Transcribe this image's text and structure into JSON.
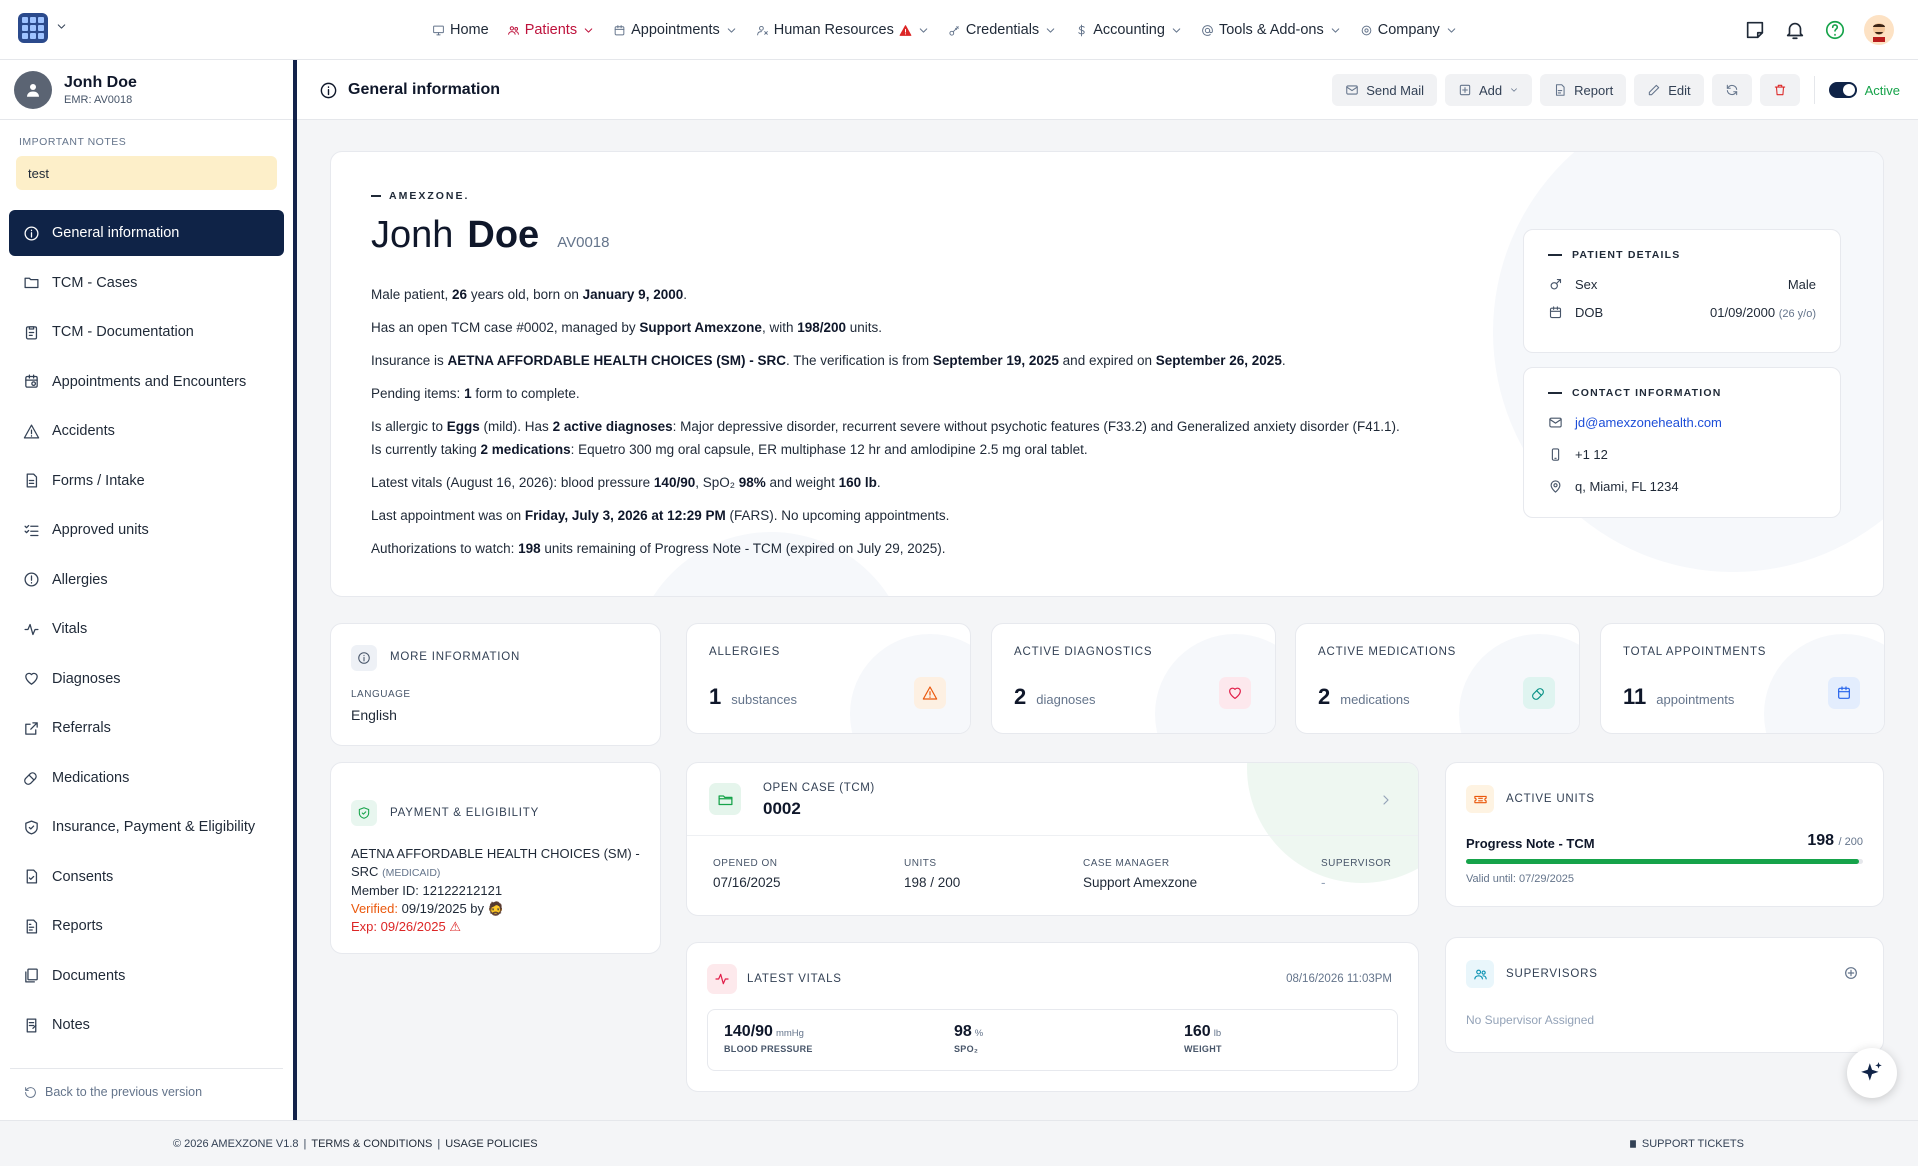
{
  "nav": {
    "items": [
      {
        "label": "Home",
        "icon": "monitor-icon"
      },
      {
        "label": "Patients",
        "icon": "users-icon"
      },
      {
        "label": "Appointments",
        "icon": "calendar-icon"
      },
      {
        "label": "Human Resources",
        "icon": "user-icon"
      },
      {
        "label": "Credentials",
        "icon": "key-icon"
      },
      {
        "label": "Accounting",
        "icon": "dollar-icon"
      },
      {
        "label": "Tools & Add-ons",
        "icon": "at-icon"
      },
      {
        "label": "Company",
        "icon": "gear-icon"
      }
    ]
  },
  "patient": {
    "name": "Jonh Doe",
    "first": "Jonh",
    "last": "Doe",
    "emr": "EMR: AV0018",
    "code": "AV0018"
  },
  "notes": {
    "label": "IMPORTANT NOTES",
    "text": "test"
  },
  "sidebar": {
    "items": [
      {
        "label": "General information",
        "icon": "info-icon"
      },
      {
        "label": "TCM - Cases",
        "icon": "folder-icon"
      },
      {
        "label": "TCM - Documentation",
        "icon": "clipboard-icon"
      },
      {
        "label": "Appointments and Encounters",
        "icon": "calendar-clock-icon"
      },
      {
        "label": "Accidents",
        "icon": "warning-icon"
      },
      {
        "label": "Forms / Intake",
        "icon": "file-icon"
      },
      {
        "label": "Approved units",
        "icon": "list-check-icon"
      },
      {
        "label": "Allergies",
        "icon": "alert-circle-icon"
      },
      {
        "label": "Vitals",
        "icon": "pulse-icon"
      },
      {
        "label": "Diagnoses",
        "icon": "heart-icon"
      },
      {
        "label": "Referrals",
        "icon": "external-link-icon"
      },
      {
        "label": "Medications",
        "icon": "pill-icon"
      },
      {
        "label": "Insurance, Payment & Eligibility",
        "icon": "shield-icon"
      },
      {
        "label": "Consents",
        "icon": "file-check-icon"
      },
      {
        "label": "Reports",
        "icon": "report-icon"
      },
      {
        "label": "Documents",
        "icon": "documents-icon"
      },
      {
        "label": "Notes",
        "icon": "note-icon"
      }
    ],
    "back": "Back to the previous version"
  },
  "header": {
    "title": "General information",
    "send_mail": "Send Mail",
    "add": "Add",
    "report": "Report",
    "edit": "Edit",
    "status": "Active"
  },
  "summary": {
    "brand": "AMEXZONE.",
    "lines": [
      [
        [
          "Male patient, ",
          false
        ],
        [
          "26",
          true
        ],
        [
          " years old, born on ",
          false
        ],
        [
          "January 9, 2000",
          true
        ],
        [
          ".",
          false
        ]
      ],
      [
        [
          "Has an open TCM case #0002, managed by ",
          false
        ],
        [
          "Support Amexzone",
          true
        ],
        [
          ", with ",
          false
        ],
        [
          "198/200",
          true
        ],
        [
          " units.",
          false
        ]
      ],
      [
        [
          "Insurance is ",
          false
        ],
        [
          "AETNA AFFORDABLE HEALTH CHOICES (SM) - SRC",
          true
        ],
        [
          ". The verification is from ",
          false
        ],
        [
          "September 19, 2025",
          true
        ],
        [
          " and expired on ",
          false
        ],
        [
          "September 26, 2025",
          true
        ],
        [
          ".",
          false
        ]
      ],
      [
        [
          "Pending items: ",
          false
        ],
        [
          "1",
          true
        ],
        [
          " form to complete.",
          false
        ]
      ],
      [
        [
          "Is allergic to ",
          false
        ],
        [
          "Eggs",
          true
        ],
        [
          " (mild). Has ",
          false
        ],
        [
          "2 active diagnoses",
          true
        ],
        [
          ": Major depressive disorder, recurrent severe without psychotic features (F33.2) and Generalized anxiety disorder (F41.1).",
          false
        ]
      ],
      [
        [
          "Is currently taking ",
          false
        ],
        [
          "2 medications",
          true
        ],
        [
          ": Equetro 300 mg oral capsule, ER multiphase 12 hr and amlodipine 2.5 mg oral tablet.",
          false
        ]
      ],
      [
        [
          "Latest vitals (August 16, 2026): blood pressure ",
          false
        ],
        [
          "140/90",
          true
        ],
        [
          ", SpO₂ ",
          false
        ],
        [
          "98%",
          true
        ],
        [
          " and weight ",
          false
        ],
        [
          "160 lb",
          true
        ],
        [
          ".",
          false
        ]
      ],
      [
        [
          "Last appointment was on ",
          false
        ],
        [
          "Friday, July 3, 2026 at 12:29 PM",
          true
        ],
        [
          " (FARS). No upcoming appointments.",
          false
        ]
      ],
      [
        [
          "Authorizations to watch: ",
          false
        ],
        [
          "198",
          true
        ],
        [
          " units remaining of Progress Note - TCM (expired on July 29, 2025).",
          false
        ]
      ]
    ]
  },
  "patient_details": {
    "title": "PATIENT DETAILS",
    "sex_label": "Sex",
    "sex_value": "Male",
    "dob_label": "DOB",
    "dob_value": "01/09/2000",
    "dob_age": "(26 y/o)"
  },
  "contact": {
    "title": "CONTACT INFORMATION",
    "email": "jd@amexzonehealth.com",
    "phone": "+1 12",
    "address": "q, Miami, FL 1234"
  },
  "more_info": {
    "title": "MORE INFORMATION",
    "language_label": "LANGUAGE",
    "language": "English"
  },
  "stats": {
    "allergies": {
      "label": "ALLERGIES",
      "value": "1",
      "unit": "substances",
      "color": "#f97316"
    },
    "diagnostics": {
      "label": "ACTIVE DIAGNOSTICS",
      "value": "2",
      "unit": "diagnoses",
      "color": "#e11d48"
    },
    "medications": {
      "label": "ACTIVE MEDICATIONS",
      "value": "2",
      "unit": "medications",
      "color": "#0d9488"
    },
    "appointments": {
      "label": "TOTAL APPOINTMENTS",
      "value": "11",
      "unit": "appointments",
      "color": "#2563eb"
    }
  },
  "payment": {
    "title": "PAYMENT & ELIGIBILITY",
    "plan": "AETNA AFFORDABLE HEALTH CHOICES (SM) - SRC",
    "plan_type": "(MEDICAID)",
    "member": "Member ID: 12122212121",
    "verified_label": "Verified:",
    "verified_value": "09/19/2025 by",
    "exp": "Exp: 09/26/2025"
  },
  "open_case": {
    "label": "OPEN CASE (TCM)",
    "number": "0002",
    "opened_label": "OPENED ON",
    "opened": "07/16/2025",
    "units_label": "UNITS",
    "units": "198 / 200",
    "manager_label": "CASE MANAGER",
    "manager": "Support Amexzone",
    "supervisor_label": "SUPERVISOR",
    "supervisor": "-"
  },
  "active_units": {
    "title": "ACTIVE UNITS",
    "name": "Progress Note - TCM",
    "used": "198",
    "total": "/ 200",
    "fraction": 0.99,
    "valid": "Valid until: 07/29/2025"
  },
  "vitals": {
    "title": "LATEST VITALS",
    "date": "08/16/2026 11:03PM",
    "bp": "140/90",
    "bp_unit": "mmHg",
    "bp_label": "BLOOD PRESSURE",
    "spo2": "98",
    "spo2_unit": "%",
    "spo2_label": "SPO₂",
    "weight": "160",
    "weight_unit": "lb",
    "weight_label": "WEIGHT"
  },
  "supervisors": {
    "title": "SUPERVISORS",
    "empty": "No Supervisor Assigned"
  },
  "footer": {
    "copyright": "© 2026 AMEXZONE V1.8",
    "terms": "TERMS & CONDITIONS",
    "usage": "USAGE POLICIES",
    "support": "SUPPORT TICKETS"
  }
}
